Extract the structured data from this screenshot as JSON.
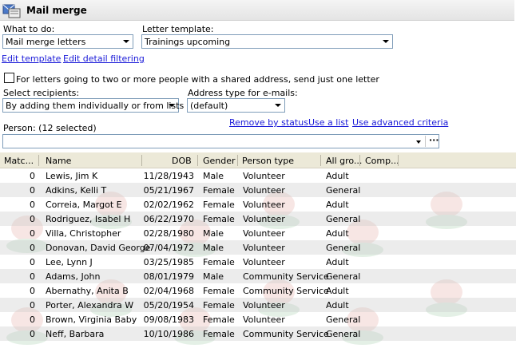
{
  "window": {
    "title": "Mail merge"
  },
  "what_to_do": {
    "label": "What to do:",
    "value": "Mail merge letters"
  },
  "letter_template": {
    "label": "Letter template:",
    "value": "Trainings upcoming"
  },
  "links": {
    "edit_template": "Edit template",
    "edit_detail_filtering": "Edit detail filtering"
  },
  "shared_address": {
    "label": "For letters going to two or more people with a shared address, send just one letter",
    "checked": false
  },
  "select_recipients": {
    "label": "Select recipients:",
    "value": "By adding them individually or from lists"
  },
  "address_type": {
    "label": "Address type for e-mails:",
    "value": "(default)"
  },
  "recipient_links": {
    "remove_by_status": "Remove by status",
    "use_a_list": "Use a list",
    "use_advanced_criteria": "Use advanced criteria"
  },
  "person": {
    "label": "Person: (12 selected)",
    "more_button": "···"
  },
  "grid": {
    "columns": [
      "Matc...",
      "Name",
      "DOB",
      "Gender",
      "Person type",
      "All gro...",
      "Comp..."
    ],
    "rows": [
      [
        "0",
        "Lewis, Jim K",
        "11/28/1943",
        "Male",
        "Volunteer",
        "Adult"
      ],
      [
        "0",
        "Adkins, Kelli T",
        "05/21/1967",
        "Female",
        "Volunteer",
        "General"
      ],
      [
        "0",
        "Correia, Margot E",
        "02/02/1962",
        "Female",
        "Volunteer",
        "Adult"
      ],
      [
        "0",
        "Rodriguez, Isabel H",
        "06/22/1970",
        "Female",
        "Volunteer",
        "General"
      ],
      [
        "0",
        "Villa, Christopher",
        "02/28/1980",
        "Male",
        "Volunteer",
        "Adult"
      ],
      [
        "0",
        "Donovan, David George",
        "07/04/1972",
        "Male",
        "Volunteer",
        "General"
      ],
      [
        "0",
        "Lee, Lynn J",
        "03/25/1985",
        "Female",
        "Volunteer",
        "Adult"
      ],
      [
        "0",
        "Adams, John",
        "08/01/1979",
        "Male",
        "Community Service",
        "General"
      ],
      [
        "0",
        "Abernathy, Anita B",
        "02/04/1968",
        "Female",
        "Community Service",
        "Adult"
      ],
      [
        "0",
        "Porter, Alexandra W",
        "05/20/1954",
        "Female",
        "Volunteer",
        "Adult"
      ],
      [
        "0",
        "Brown, Virginia Baby",
        "09/08/1983",
        "Female",
        "Volunteer",
        "General"
      ],
      [
        "0",
        "Neff, Barbara",
        "10/10/1986",
        "Female",
        "Community Service",
        "General"
      ]
    ]
  },
  "colors": {
    "link": "#1a1ad8",
    "header_bg": "#ece9d8",
    "alt_row": "#e6e6e6",
    "border": "#7f9db9"
  }
}
